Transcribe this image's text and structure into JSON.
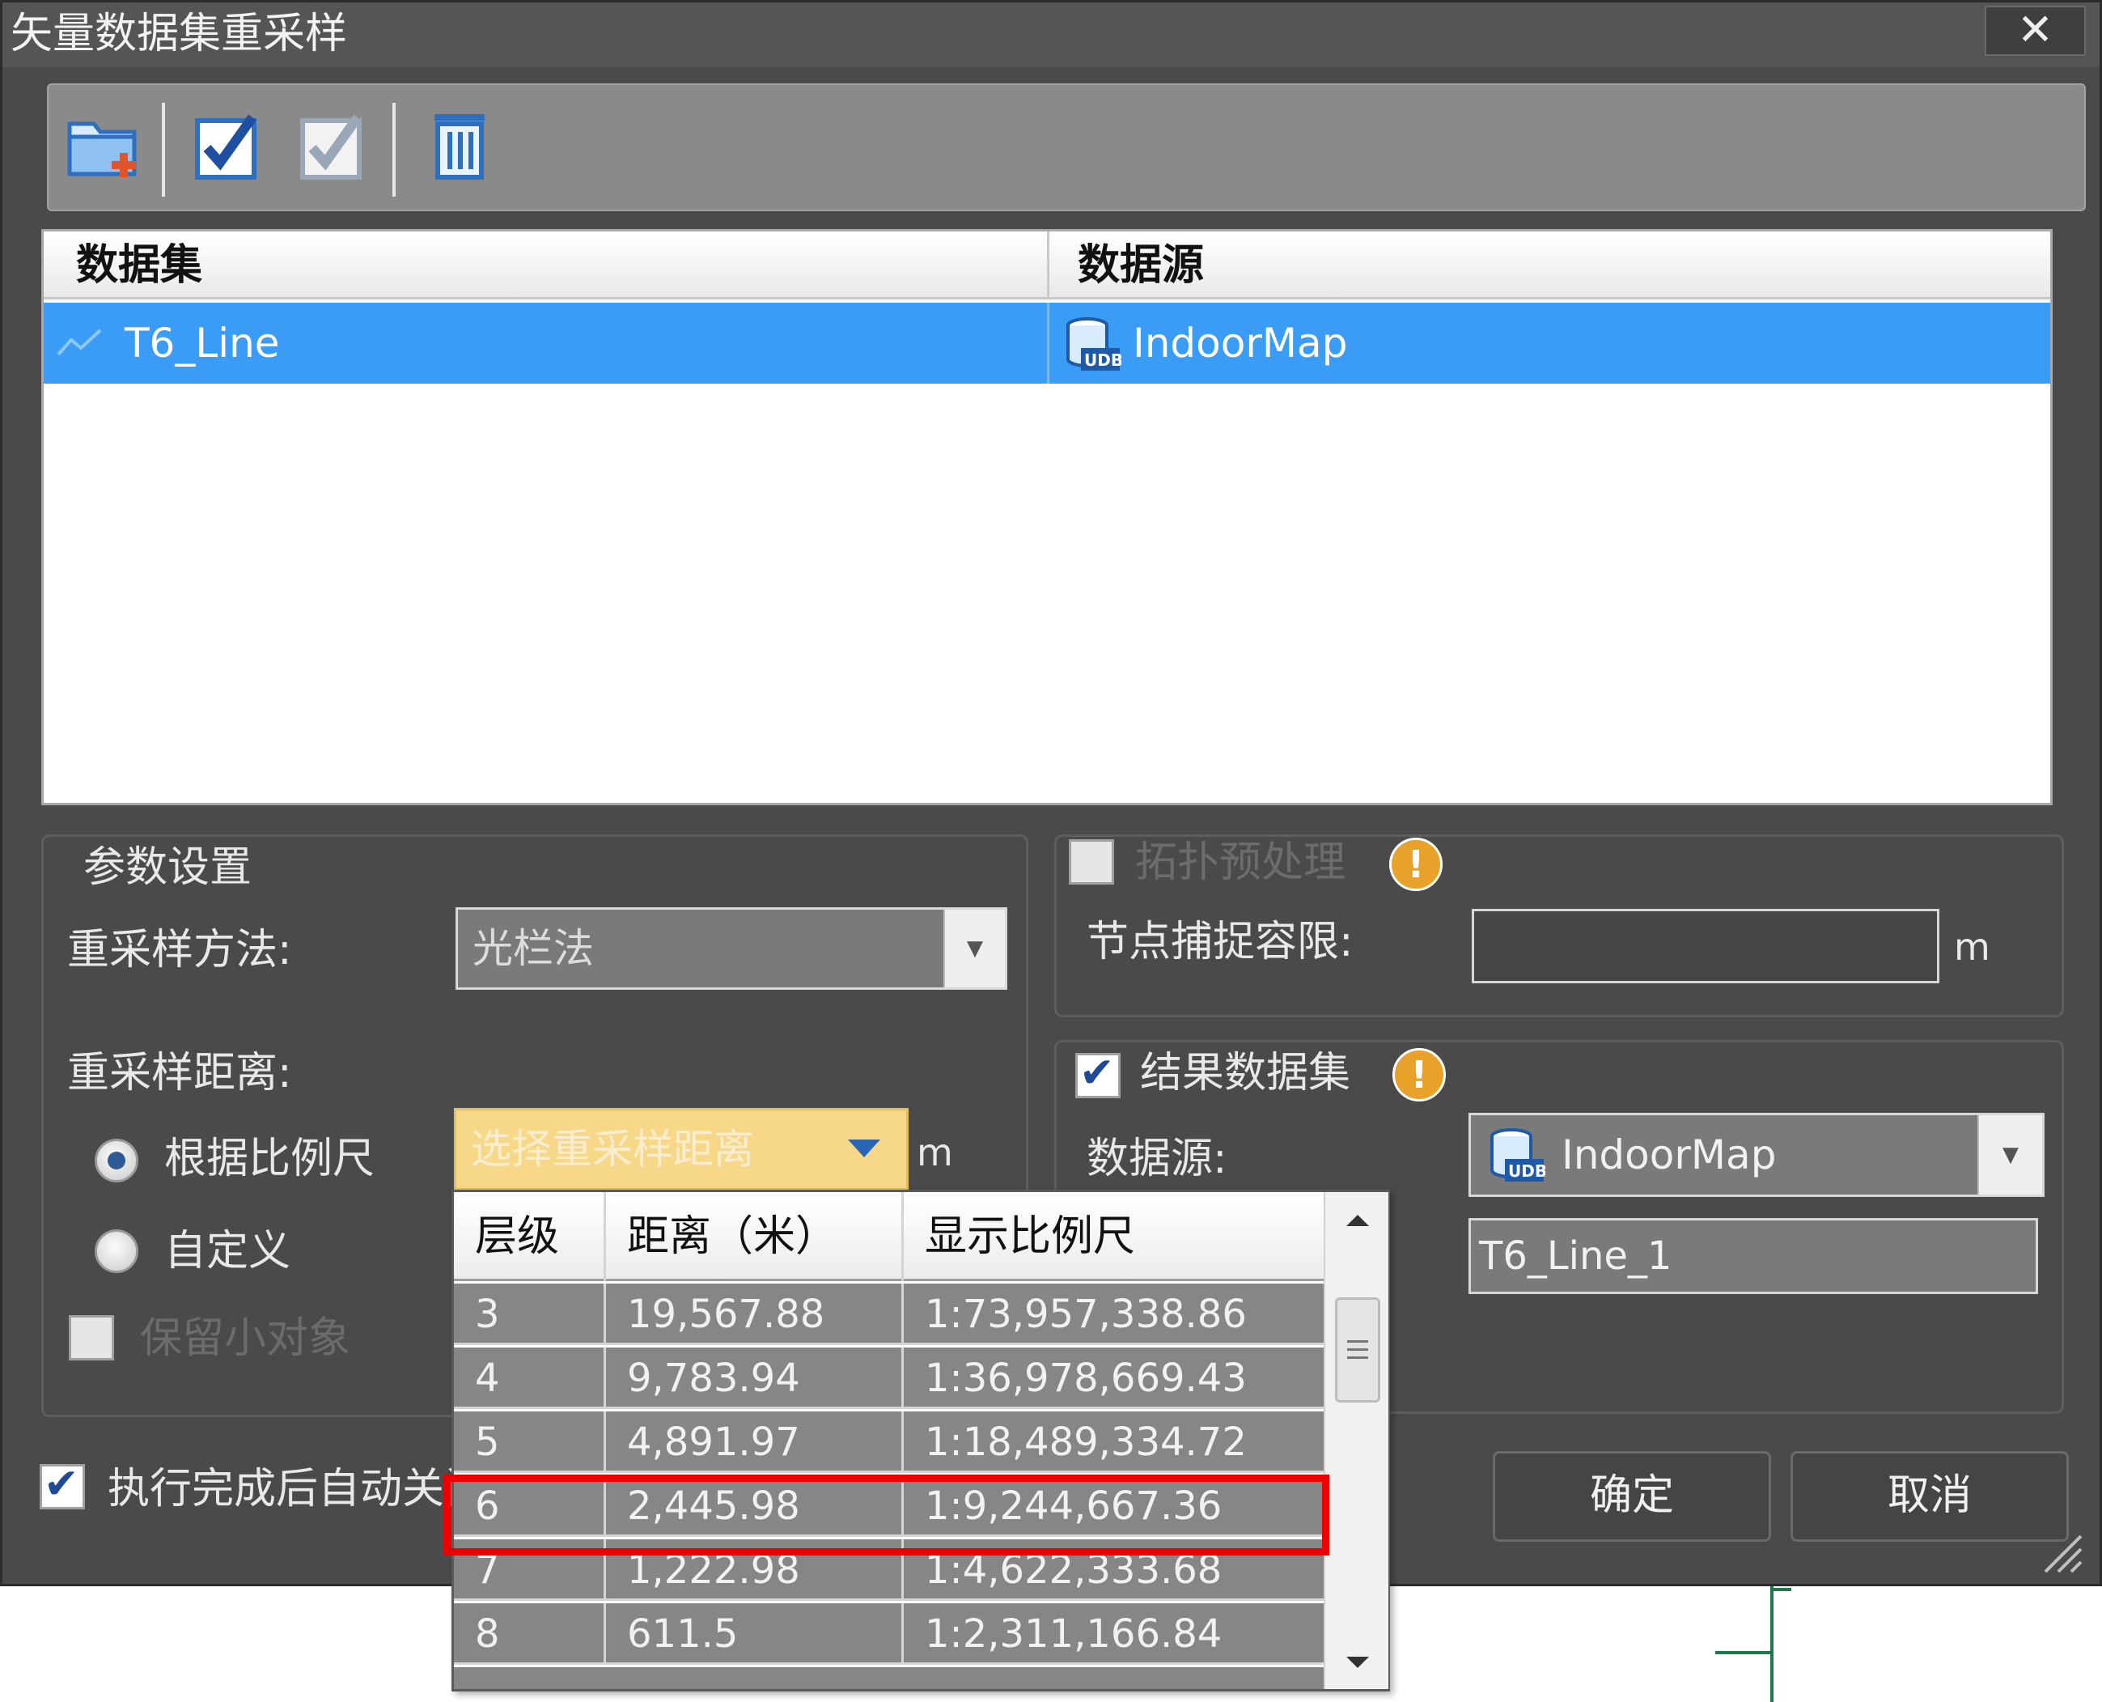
{
  "window": {
    "title": "矢量数据集重采样",
    "close_glyph": "✕"
  },
  "toolbar": {
    "add": "folder-add-icon",
    "select_all": "check-all-icon",
    "invert": "check-invert-icon",
    "delete": "trash-icon"
  },
  "table": {
    "columns": [
      "数据集",
      "数据源"
    ],
    "rows": [
      {
        "dataset": "T6_Line",
        "datasource": "IndoorMap",
        "selected": true
      }
    ]
  },
  "params": {
    "group_title": "参数设置",
    "method_label": "重采样方法:",
    "method_value": "光栏法",
    "distance_label": "重采样距离:",
    "radio_scale": "根据比例尺",
    "radio_custom": "自定义",
    "distance_placeholder": "选择重采样距离",
    "unit": "m",
    "keep_small_label": "保留小对象"
  },
  "topology": {
    "title": "拓扑预处理",
    "snap_label": "节点捕捉容限:",
    "unit": "m",
    "warn": "!"
  },
  "result": {
    "title": "结果数据集",
    "datasource_label": "数据源:",
    "datasource_value": "IndoorMap",
    "dataset_value": "T6_Line_1",
    "warn": "!"
  },
  "footer": {
    "auto_close_label": "执行完成后自动关闭",
    "ok": "确定",
    "cancel": "取消"
  },
  "dropdown": {
    "columns": [
      "层级",
      "距离（米）",
      "显示比例尺"
    ],
    "rows": [
      {
        "level": "3",
        "distance": "19,567.88",
        "scale": "1:73,957,338.86"
      },
      {
        "level": "4",
        "distance": "9,783.94",
        "scale": "1:36,978,669.43"
      },
      {
        "level": "5",
        "distance": "4,891.97",
        "scale": "1:18,489,334.72"
      },
      {
        "level": "6",
        "distance": "2,445.98",
        "scale": "1:9,244,667.36",
        "highlighted": true
      },
      {
        "level": "7",
        "distance": "1,222.98",
        "scale": "1:4,622,333.68"
      },
      {
        "level": "8",
        "distance": "611.5",
        "scale": "1:2,311,166.84"
      }
    ]
  },
  "colors": {
    "selection": "#3a9cf5",
    "highlight_box": "#ee0000",
    "warning": "#e8a22a",
    "dialog_bg": "#4a4a4a",
    "dropdown_field": "#f7d889"
  }
}
